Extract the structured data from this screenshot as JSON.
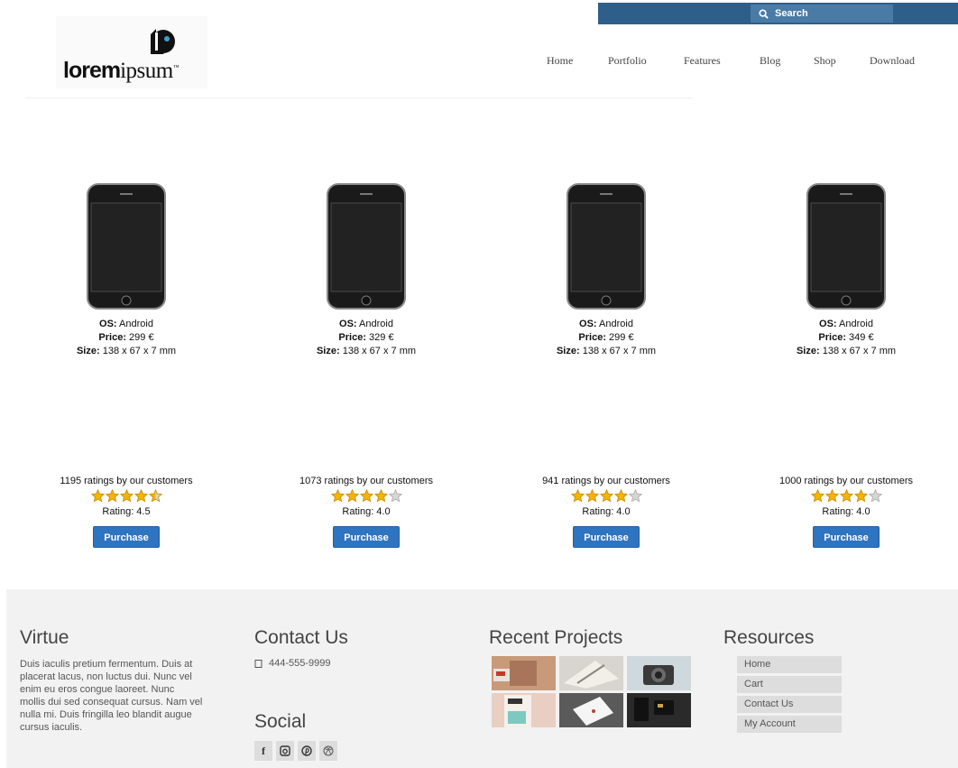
{
  "search": {
    "label": "Search"
  },
  "logo": {
    "bold": "lorem",
    "rest": "ipsum",
    "tm": "™"
  },
  "nav": [
    {
      "label": "Home"
    },
    {
      "label": "Portfolio"
    },
    {
      "label": "Features"
    },
    {
      "label": "Blog"
    },
    {
      "label": "Shop"
    },
    {
      "label": "Download"
    }
  ],
  "spec_labels": {
    "os": "OS:",
    "price": "Price:",
    "size": "Size:"
  },
  "products": [
    {
      "os": "Android",
      "price": "299 €",
      "size": "138 x 67 x 7 mm",
      "ratings_text": "1195 ratings by our customers",
      "rating": 4.5,
      "rating_text": "Rating: 4.5",
      "button": "Purchase"
    },
    {
      "os": "Android",
      "price": "329 €",
      "size": "138 x 67 x 7 mm",
      "ratings_text": "1073 ratings by our customers",
      "rating": 4.0,
      "rating_text": "Rating: 4.0",
      "button": "Purchase"
    },
    {
      "os": "Android",
      "price": "299 €",
      "size": "138 x 67 x 7 mm",
      "ratings_text": "941 ratings by our customers",
      "rating": 4.0,
      "rating_text": "Rating: 4.0",
      "button": "Purchase"
    },
    {
      "os": "Android",
      "price": "349 €",
      "size": "138 x 67 x 7 mm",
      "ratings_text": "1000 ratings by our customers",
      "rating": 4.0,
      "rating_text": "Rating: 4.0",
      "button": "Purchase"
    }
  ],
  "footer": {
    "virtue": {
      "title": "Virtue",
      "lines": [
        "Duis iaculis pretium fermentum. Duis at",
        "placerat lacus, non luctus dui. Nunc vel",
        "enim eu eros congue laoreet. Nunc",
        "mollis dui sed consequat cursus. Nam vel",
        "nulla mi. Duis fringilla leo blandit augue",
        "cursus iaculis."
      ]
    },
    "contact": {
      "title": "Contact Us",
      "phone": "444-555-9999"
    },
    "social": {
      "title": "Social",
      "icons": [
        "facebook-icon",
        "instagram-icon",
        "pinterest-icon",
        "dribbble-icon"
      ],
      "facebook_glyph": "f"
    },
    "projects": {
      "title": "Recent Projects"
    },
    "resources": {
      "title": "Resources",
      "items": [
        {
          "label": "Home"
        },
        {
          "label": "Cart"
        },
        {
          "label": "Contact Us"
        },
        {
          "label": "My Account"
        }
      ]
    }
  },
  "colors": {
    "searchbar": "#2e5e8a",
    "button": "#2f74c0",
    "footer": "#f2f2f2",
    "star": "#f5b400"
  }
}
